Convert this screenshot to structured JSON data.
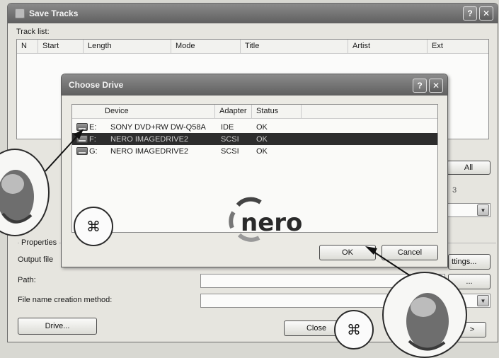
{
  "main_window": {
    "title": "Save Tracks",
    "help_button": "?",
    "close_button": "✕",
    "track_list_label": "Track list:",
    "columns": [
      "N",
      "Start",
      "Length",
      "Mode",
      "Title",
      "Artist",
      "Ext"
    ],
    "all_button": "All",
    "spinner_value": "3",
    "properties_label": "Properties",
    "output_file_label": "Output file",
    "settings_button": "ttings...",
    "path_label": "Path:",
    "path_browse_button": "...",
    "file_name_label": "File name creation method:",
    "drive_button": "Drive...",
    "close_btn": "Close",
    "next_button": ">"
  },
  "dialog": {
    "title": "Choose Drive",
    "help_button": "?",
    "close_button": "✕",
    "columns": [
      "Device",
      "Adapter",
      "Status"
    ],
    "drives": [
      {
        "letter": "E:",
        "device": "SONY DVD+RW DW-Q58A",
        "adapter": "IDE",
        "status": "OK",
        "selected": false
      },
      {
        "letter": "F:",
        "device": "NERO IMAGEDRIVE2",
        "adapter": "SCSI",
        "status": "OK",
        "selected": true
      },
      {
        "letter": "G:",
        "device": "NERO IMAGEDRIVE2",
        "adapter": "SCSI",
        "status": "OK",
        "selected": false
      }
    ],
    "logo_text": "nero",
    "ok_button": "OK",
    "cancel_button": "Cancel"
  },
  "icons": [
    "drive-icon",
    "mouse-hand-icon",
    "double-click-icon",
    "arrow-pointer-icon",
    "dropdown-arrow-icon",
    "nero-logo-icon"
  ],
  "colors": {
    "selection": "#2d2d2d",
    "titlebar": "#6d6d6d"
  }
}
